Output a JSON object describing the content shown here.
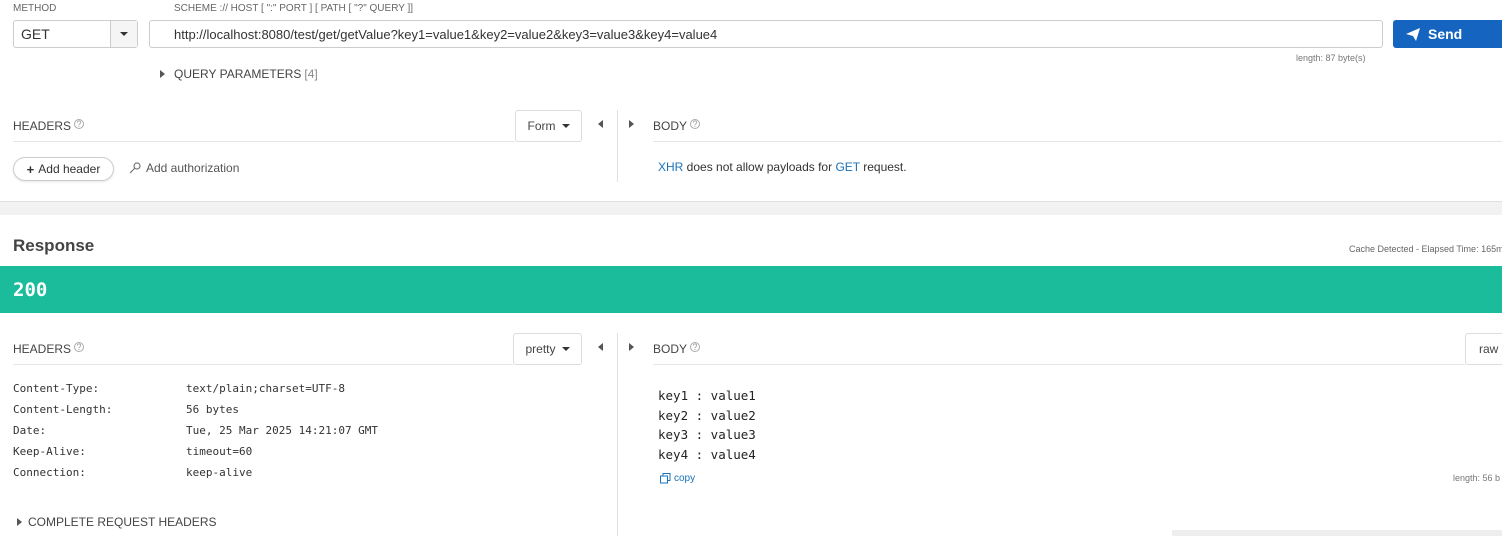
{
  "request": {
    "method_label": "METHOD",
    "method_value": "GET",
    "url_label": "SCHEME :// HOST [ \":\" PORT ] [ PATH [ \"?\" QUERY ]]",
    "url_value": "http://localhost:8080/test/get/getValue?key1=value1&key2=value2&key3=value3&key4=value4",
    "send_label": "Send",
    "length_text": "length: 87 byte(s)",
    "query_params_label": "QUERY PARAMETERS",
    "query_params_count": "[4]",
    "headers_label": "HEADERS",
    "headers_mode": "Form",
    "add_header_label": "Add header",
    "add_authorization_label": "Add authorization",
    "body_label": "BODY",
    "body_msg_xhr": "XHR",
    "body_msg_mid": " does not allow payloads for ",
    "body_msg_method": "GET",
    "body_msg_end": " request."
  },
  "response": {
    "title": "Response",
    "cache_info": "Cache Detected - Elapsed Time: 165m",
    "status_code": "200",
    "headers_label": "HEADERS",
    "headers_mode": "pretty",
    "headers": [
      {
        "name": "Content-Type:",
        "value": "text/plain;charset=UTF-8"
      },
      {
        "name": "Content-Length:",
        "value": "56 bytes"
      },
      {
        "name": "Date:",
        "value": "Tue, 25 Mar 2025 14:21:07 GMT"
      },
      {
        "name": "Keep-Alive:",
        "value": "timeout=60"
      },
      {
        "name": "Connection:",
        "value": "keep-alive"
      }
    ],
    "complete_headers_label": "COMPLETE REQUEST HEADERS",
    "body_label": "BODY",
    "body_mode": "raw",
    "body_lines": [
      "key1 : value1",
      "key2 : value2",
      "key3 : value3",
      "key4 : value4"
    ],
    "copy_label": "copy",
    "length_text": "length: 56 b"
  },
  "colors": {
    "accent": "#1565c0",
    "status_ok": "#1abc9c",
    "link": "#1a73b8"
  }
}
